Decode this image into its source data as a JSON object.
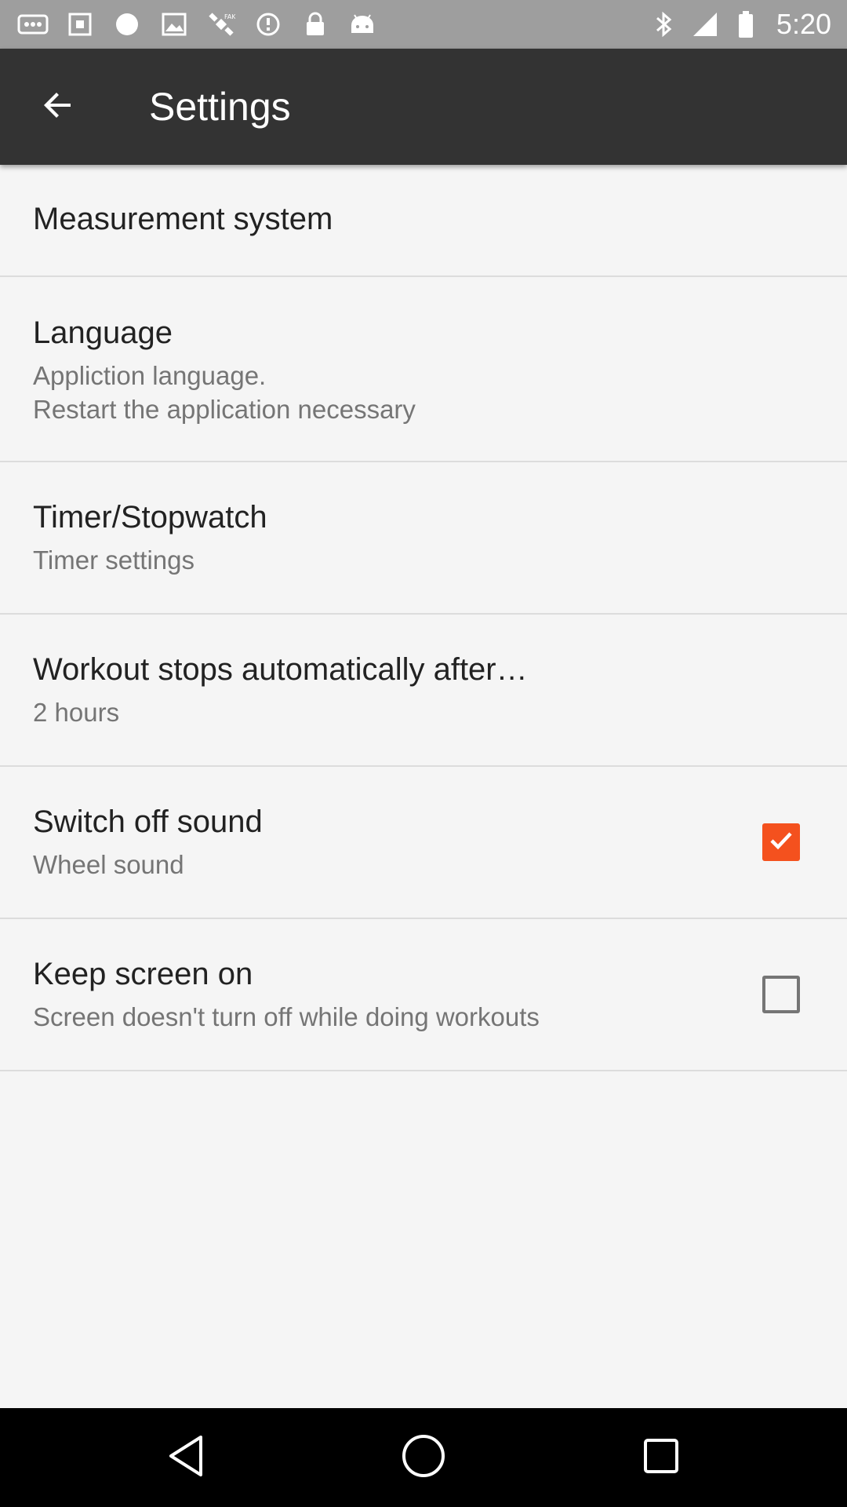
{
  "status_bar": {
    "time": "5:20",
    "left_icons": [
      "more-icon",
      "settings-icon",
      "ring-icon",
      "image-icon",
      "satellite-icon",
      "data-saver-icon",
      "lock-icon",
      "android-icon"
    ],
    "right_icons": [
      "bluetooth-icon",
      "signal-icon",
      "battery-icon"
    ]
  },
  "app_bar": {
    "title": "Settings",
    "back_icon": "arrow-back-icon"
  },
  "settings": [
    {
      "title": "Measurement system"
    },
    {
      "title": "Language",
      "summary": "Appliction language.\nRestart the application necessary"
    },
    {
      "title": "Timer/Stopwatch",
      "summary": "Timer settings"
    },
    {
      "title": "Workout stops automatically after…",
      "summary": "2 hours"
    },
    {
      "title": "Switch off sound",
      "summary": "Wheel sound",
      "checked": true
    },
    {
      "title": "Keep screen on",
      "summary": "Screen doesn't turn off while doing workouts",
      "checked": false
    }
  ],
  "colors": {
    "app_bar": "#333333",
    "accent": "#f4511e",
    "background": "#f5f5f5",
    "status_bar": "#9e9e9e"
  },
  "nav_bar": {
    "buttons": [
      "back-triangle-icon",
      "home-circle-icon",
      "recents-square-icon"
    ]
  }
}
